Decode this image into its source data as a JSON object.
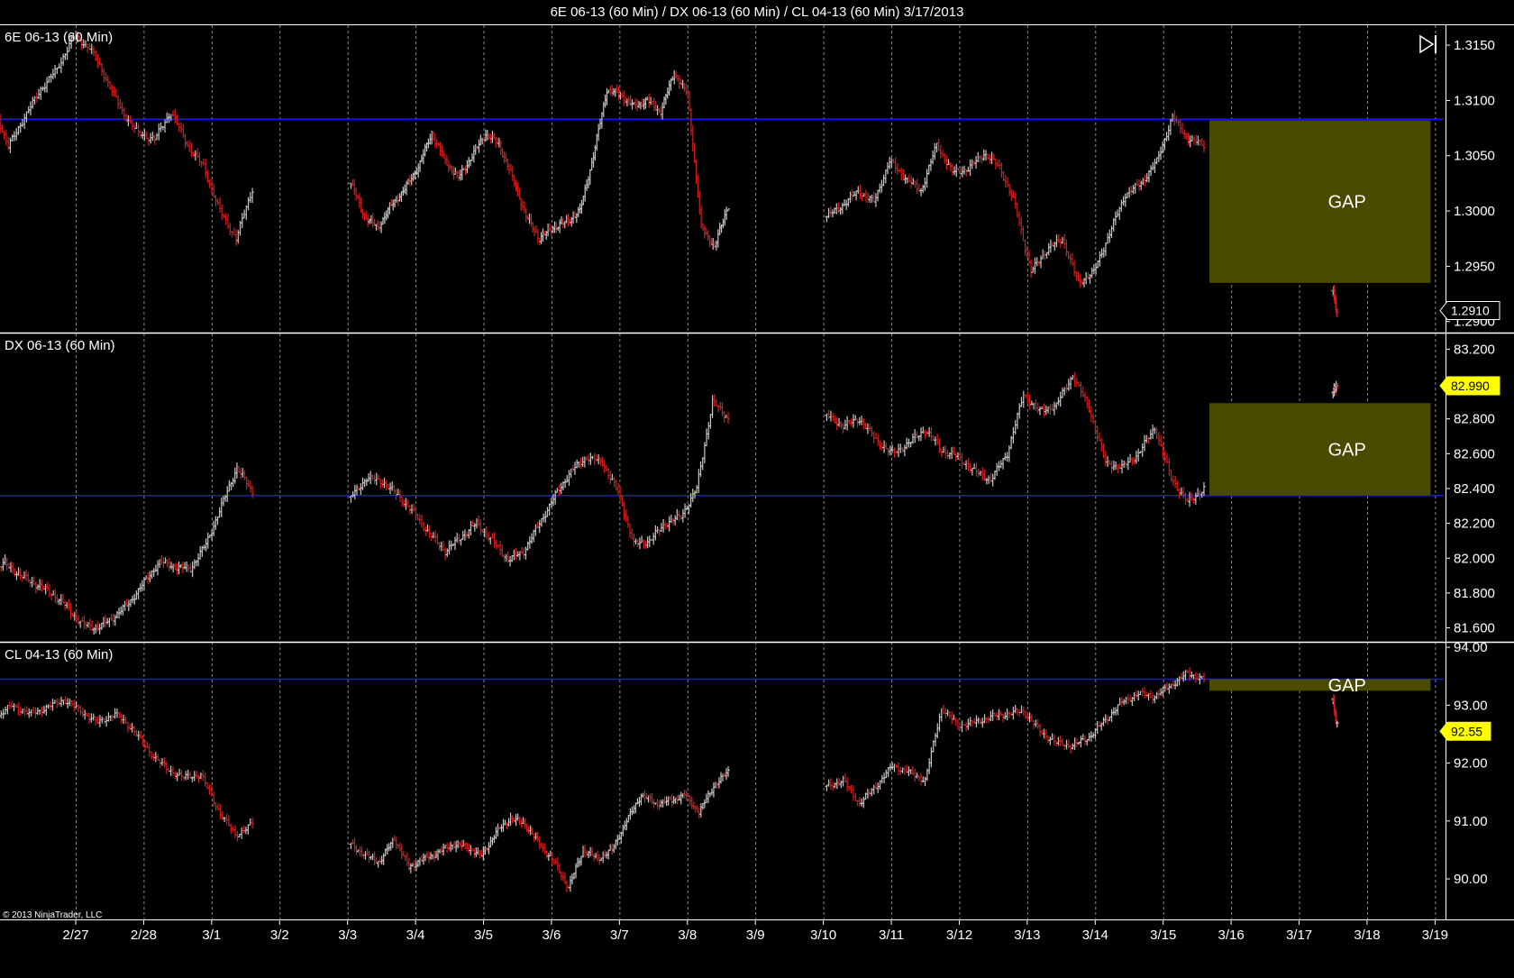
{
  "window": {
    "title": "6E 06-13 (60 Min) / DX 06-13 (60 Min) / CL 04-13 (60 Min)  3/17/2013",
    "copyright": "© 2013 NinjaTrader, LLC"
  },
  "colors": {
    "background": "#000000",
    "up_bar": "#c8c8c8",
    "down_bar": "#d21e1e",
    "reference_line": "#1a1ae6",
    "gap_fill": "#4b4b00",
    "flag_yellow": "#ffff00"
  },
  "chart_data": [
    {
      "type": "ohlc",
      "panel_label": "6E 06-13 (60 Min)",
      "ylim": [
        1.289,
        1.3168
      ],
      "y_ticks": [
        "1.3150",
        "1.3100",
        "1.3050",
        "1.3000",
        "1.2950",
        "1.2900"
      ],
      "reference_line": 1.3083,
      "last_price": "1.2910",
      "last_price_style": "white",
      "gap": {
        "label": "GAP",
        "from_date": "3/15",
        "to_date": "3/19",
        "high": 1.3082,
        "low": 1.2935
      },
      "segments": [
        {
          "from": "2/26",
          "to": "3/1",
          "points": [
            1.306,
            1.3095,
            1.305,
            1.3098,
            1.3058,
            1.3085,
            1.311,
            1.3128,
            1.3158,
            1.3148,
            1.312,
            1.309,
            1.307,
            1.3065,
            1.309,
            1.306,
            1.304,
            1.3,
            1.2975,
            1.302
          ]
        },
        {
          "from": "3/4",
          "to": "3/8",
          "points": [
            1.3025,
            1.2995,
            1.2985,
            1.3005,
            1.302,
            1.304,
            1.307,
            1.3045,
            1.303,
            1.305,
            1.307,
            1.306,
            1.303,
            1.2995,
            1.2975,
            1.2985,
            1.299,
            1.3,
            1.305,
            1.311,
            1.3105,
            1.3095,
            1.31,
            1.309,
            1.3125,
            1.3105,
            1.2985,
            1.2968,
            1.3005
          ]
        },
        {
          "from": "3/11",
          "to": "3/15",
          "points": [
            1.2995,
            1.3005,
            1.3018,
            1.3008,
            1.3045,
            1.303,
            1.3018,
            1.306,
            1.3035,
            1.3038,
            1.3052,
            1.304,
            1.3005,
            1.2945,
            1.2965,
            1.2975,
            1.2935,
            1.2945,
            1.298,
            1.3015,
            1.3025,
            1.3045,
            1.3085,
            1.3065,
            1.306
          ]
        },
        {
          "from": "3/17",
          "to": "3/17",
          "points": [
            1.2928,
            1.2908
          ]
        }
      ]
    },
    {
      "type": "ohlc",
      "panel_label": "DX 06-13 (60 Min)",
      "ylim": [
        81.52,
        83.29
      ],
      "y_ticks": [
        "83.200",
        "83.000",
        "82.800",
        "82.600",
        "82.400",
        "82.200",
        "82.000",
        "81.800",
        "81.600"
      ],
      "reference_line": 82.36,
      "last_price": "82.990",
      "last_price_style": "yellow",
      "gap": {
        "label": "GAP",
        "from_date": "3/15",
        "to_date": "3/19",
        "high": 82.89,
        "low": 82.36
      },
      "segments": [
        {
          "from": "2/26",
          "to": "3/1",
          "points": [
            81.94,
            81.96,
            81.88,
            81.92,
            81.97,
            81.9,
            81.85,
            81.8,
            81.72,
            81.62,
            81.6,
            81.66,
            81.74,
            81.86,
            81.98,
            81.95,
            81.94,
            82.08,
            82.3,
            82.52,
            82.38
          ]
        },
        {
          "from": "3/4",
          "to": "3/8",
          "points": [
            82.35,
            82.46,
            82.44,
            82.36,
            82.26,
            82.14,
            82.04,
            82.12,
            82.2,
            82.1,
            81.99,
            82.04,
            82.2,
            82.36,
            82.5,
            82.58,
            82.55,
            82.38,
            82.08,
            82.1,
            82.2,
            82.24,
            82.4,
            82.9,
            82.8
          ]
        },
        {
          "from": "3/11",
          "to": "3/15",
          "points": [
            82.82,
            82.76,
            82.8,
            82.68,
            82.6,
            82.66,
            82.74,
            82.62,
            82.58,
            82.5,
            82.45,
            82.6,
            82.94,
            82.84,
            82.88,
            83.05,
            82.86,
            82.55,
            82.52,
            82.6,
            82.75,
            82.46,
            82.32,
            82.4
          ]
        },
        {
          "from": "3/17",
          "to": "3/17",
          "points": [
            82.95,
            83.0
          ]
        }
      ]
    },
    {
      "type": "ohlc",
      "panel_label": "CL 04-13 (60 Min)",
      "ylim": [
        89.3,
        94.08
      ],
      "y_ticks": [
        "94.00",
        "93.00",
        "92.00",
        "91.00",
        "90.00"
      ],
      "reference_line": 93.45,
      "last_price": "92.55",
      "last_price_style": "yellow",
      "gap": {
        "label": "GAP",
        "from_date": "3/15",
        "to_date": "3/19",
        "high": 93.45,
        "low": 93.25
      },
      "segments": [
        {
          "from": "2/26",
          "to": "3/1",
          "points": [
            92.6,
            92.85,
            92.9,
            92.75,
            93.0,
            92.85,
            92.95,
            93.1,
            92.9,
            92.7,
            92.85,
            92.6,
            92.2,
            91.9,
            91.75,
            91.8,
            91.2,
            90.75,
            90.95
          ]
        },
        {
          "from": "3/4",
          "to": "3/8",
          "points": [
            90.6,
            90.4,
            90.3,
            90.7,
            90.2,
            90.35,
            90.45,
            90.6,
            90.55,
            90.4,
            90.8,
            91.05,
            90.95,
            90.6,
            90.3,
            89.85,
            90.5,
            90.35,
            90.5,
            91.0,
            91.45,
            91.3,
            91.35,
            91.45,
            91.15,
            91.6,
            91.85
          ]
        },
        {
          "from": "3/11",
          "to": "3/15",
          "points": [
            91.6,
            91.7,
            91.3,
            91.6,
            91.95,
            91.85,
            91.7,
            92.95,
            92.65,
            92.7,
            92.8,
            92.85,
            92.9,
            92.55,
            92.35,
            92.3,
            92.45,
            92.75,
            93.05,
            93.2,
            93.15,
            93.35,
            93.55,
            93.45
          ]
        },
        {
          "from": "3/17",
          "to": "3/17",
          "points": [
            93.1,
            92.65
          ]
        }
      ]
    }
  ],
  "x_axis": {
    "ticks": [
      "2/27",
      "2/28",
      "3/1",
      "3/2",
      "3/3",
      "3/4",
      "3/5",
      "3/6",
      "3/7",
      "3/8",
      "3/9",
      "3/10",
      "3/11",
      "3/12",
      "3/13",
      "3/14",
      "3/15",
      "3/16",
      "3/17",
      "3/18",
      "3/19"
    ],
    "gridlines_dashed": true
  }
}
